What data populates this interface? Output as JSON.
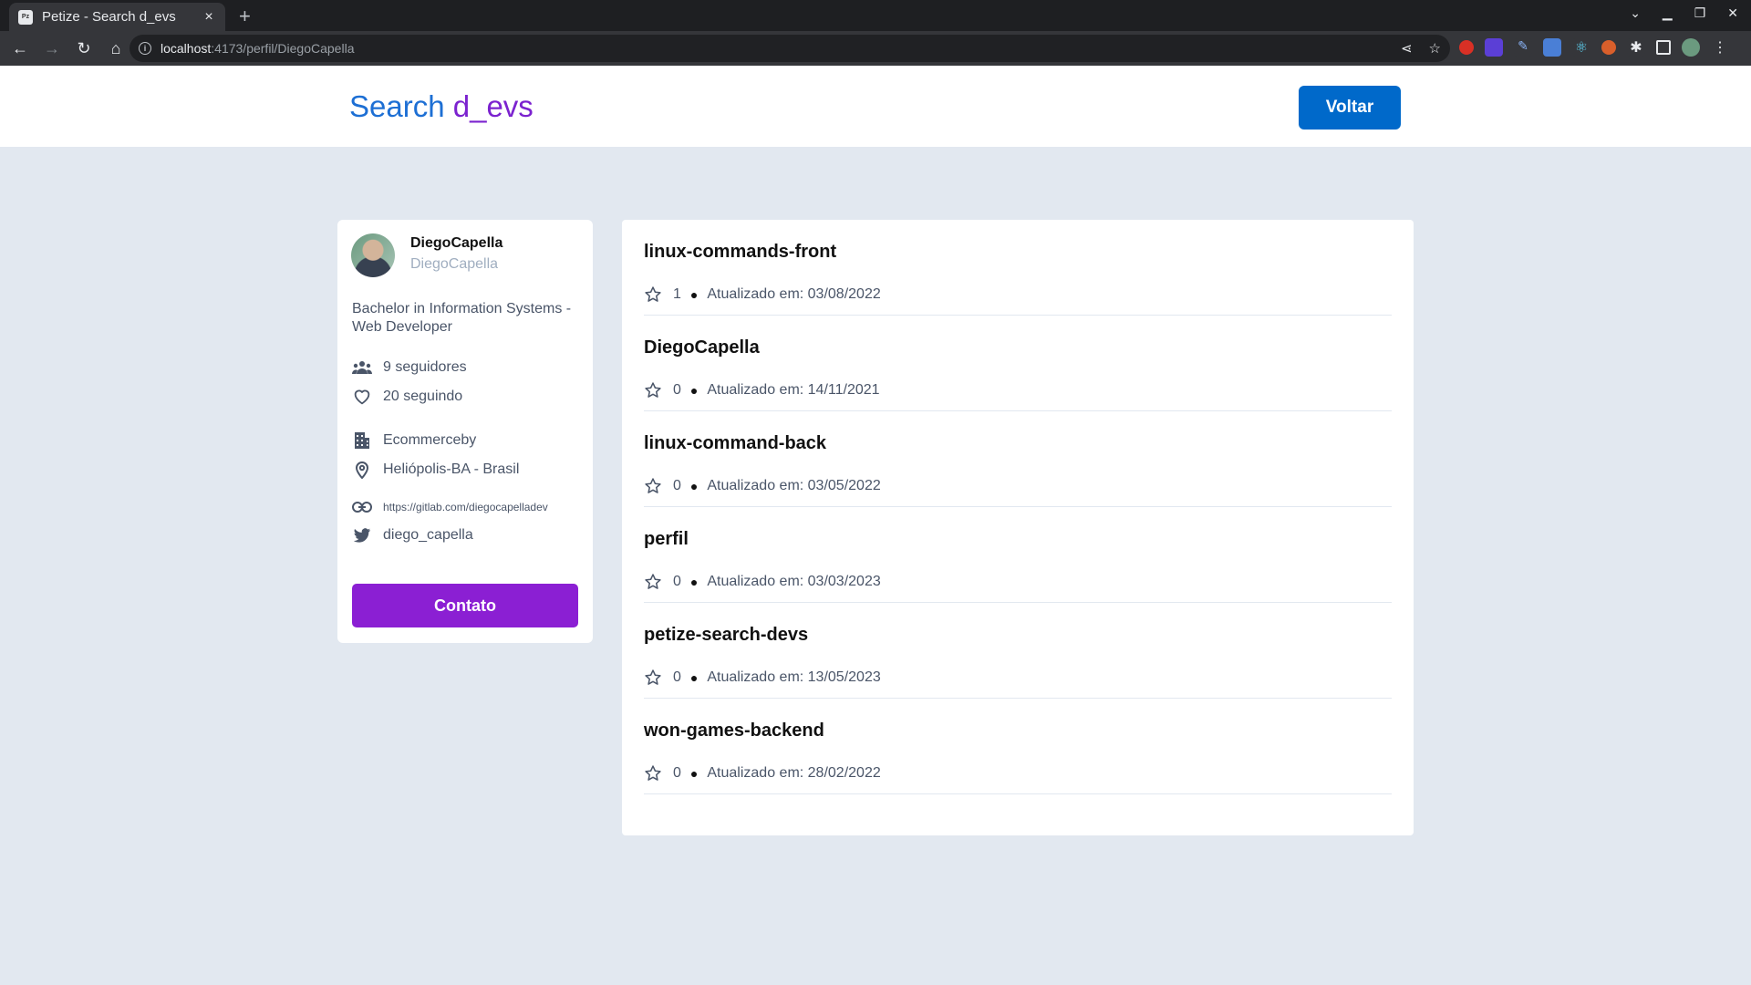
{
  "browser": {
    "tab_title": "Petize - Search d_evs",
    "tab_close": "×",
    "new_tab": "+",
    "url_host": "localhost",
    "url_rest": ":4173/perfil/DiegoCapella"
  },
  "header": {
    "logo_part1": "Search ",
    "logo_part2": "d_evs",
    "back_label": "Voltar"
  },
  "profile": {
    "name": "DiegoCapella",
    "login": "DiegoCapella",
    "bio": "Bachelor in Information Systems - Web Developer",
    "followers": "9 seguidores",
    "following": "20 seguindo",
    "company": "Ecommerceby",
    "location": "Heliópolis-BA - Brasil",
    "blog": "https://gitlab.com/diegocapelladev",
    "twitter": "diego_capella",
    "contact_label": "Contato"
  },
  "repos": [
    {
      "name": "linux-commands-front",
      "stars": "1",
      "updated": "Atualizado em: 03/08/2022"
    },
    {
      "name": "DiegoCapella",
      "stars": "0",
      "updated": "Atualizado em: 14/11/2021"
    },
    {
      "name": "linux-command-back",
      "stars": "0",
      "updated": "Atualizado em: 03/05/2022"
    },
    {
      "name": "perfil",
      "stars": "0",
      "updated": "Atualizado em: 03/03/2023"
    },
    {
      "name": "petize-search-devs",
      "stars": "0",
      "updated": "Atualizado em: 13/05/2023"
    },
    {
      "name": "won-games-backend",
      "stars": "0",
      "updated": "Atualizado em: 28/02/2022"
    }
  ],
  "colors": {
    "primary_blue": "#0069ca",
    "purple": "#8b1fd3",
    "page_bg": "#e2e8f0"
  }
}
